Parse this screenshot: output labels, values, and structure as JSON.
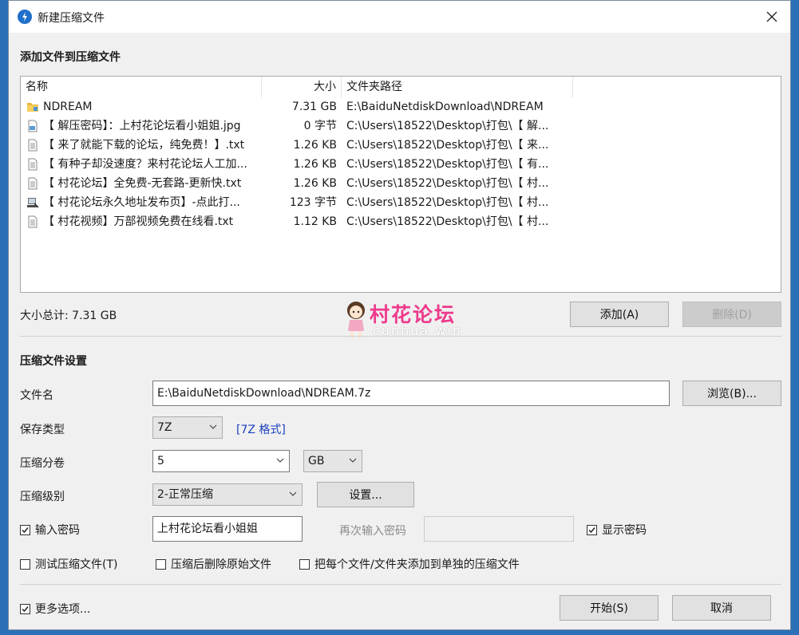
{
  "window": {
    "title": "新建压缩文件",
    "close_glyph": "✕",
    "app_icon": "bandizip-icon"
  },
  "files_section": {
    "title": "添加文件到压缩文件",
    "columns": {
      "name": "名称",
      "size": "大小",
      "path": "文件夹路径"
    },
    "rows": [
      {
        "name": "NDREAM",
        "size": "7.31 GB",
        "path": "E:\\BaiduNetdiskDownload\\NDREAM",
        "icon": "folder-icon"
      },
      {
        "name": "【 解压密码】：上村花论坛看小姐姐.jpg",
        "size": "0 字节",
        "path": "C:\\Users\\18522\\Desktop\\打包\\【 解...",
        "icon": "image-file-icon"
      },
      {
        "name": "【 来了就能下载的论坛，纯免费！】.txt",
        "size": "1.26 KB",
        "path": "C:\\Users\\18522\\Desktop\\打包\\【 来...",
        "icon": "text-file-icon"
      },
      {
        "name": "【 有种子却没速度？来村花论坛人工加...",
        "size": "1.26 KB",
        "path": "C:\\Users\\18522\\Desktop\\打包\\【 有...",
        "icon": "text-file-icon"
      },
      {
        "name": "【 村花论坛】全免费-无套路-更新快.txt",
        "size": "1.26 KB",
        "path": "C:\\Users\\18522\\Desktop\\打包\\【 村...",
        "icon": "text-file-icon"
      },
      {
        "name": "【 村花论坛永久地址发布页】-点此打...",
        "size": "123 字节",
        "path": "C:\\Users\\18522\\Desktop\\打包\\【 村...",
        "icon": "shortcut-file-icon"
      },
      {
        "name": "【 村花视频】万部视频免费在线看.txt",
        "size": "1.12 KB",
        "path": "C:\\Users\\18522\\Desktop\\打包\\【 村...",
        "icon": "text-file-icon"
      }
    ],
    "total_size": "大小总计: 7.31 GB",
    "add_button": "添加(A)",
    "delete_button": "删除(D)"
  },
  "watermark": {
    "text": "村花论坛",
    "subtext": "cunhua.win"
  },
  "settings": {
    "title": "压缩文件设置",
    "filename_label": "文件名",
    "filename_value": "E:\\BaiduNetdiskDownload\\NDREAM.7z",
    "browse_button": "浏览(B)...",
    "save_type_label": "保存类型",
    "save_type_value": "7Z",
    "format_link": "[7Z 格式]",
    "split_label": "压缩分卷",
    "split_value": "5",
    "split_unit": "GB",
    "level_label": "压缩级别",
    "level_value": "2-正常压缩",
    "level_settings_button": "设置...",
    "password_check_label": "输入密码",
    "password_checked": true,
    "password_value": "上村花论坛看小姐姐",
    "reenter_label": "再次输入密码",
    "reenter_value": "",
    "show_password_label": "显示密码",
    "show_password_checked": true,
    "test_label": "测试压缩文件(T)",
    "test_checked": false,
    "delete_after_label": "压缩后删除原始文件",
    "delete_after_checked": false,
    "each_separate_label": "把每个文件/文件夹添加到单独的压缩文件",
    "each_separate_checked": false
  },
  "footer": {
    "more_options_label": "更多选项...",
    "more_options_checked": true,
    "start_button": "开始(S)",
    "cancel_button": "取消"
  }
}
